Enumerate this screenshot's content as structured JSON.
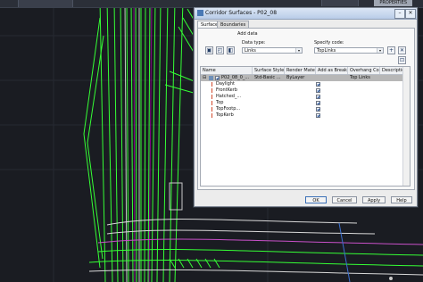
{
  "topbar": {
    "properties_label": "PROPERTIES"
  },
  "dialog": {
    "title": "Corridor Surfaces - P02_08",
    "tabs": [
      {
        "label": "Surfaces"
      },
      {
        "label": "Boundaries"
      }
    ],
    "add_data_label": "Add data",
    "data_type_label": "Data type:",
    "data_type_value": "Links",
    "specify_code_label": "Specify code:",
    "specify_code_value": "TopLinks",
    "table": {
      "columns": [
        "Name",
        "Surface Style",
        "Render Mater...",
        "Add as Breakl...",
        "Overhang Co...",
        "Description"
      ],
      "rows": [
        {
          "name": "P02_08_0_...",
          "surface_style": "Std-Basic ...",
          "render_material": "ByLayer",
          "overhang": "Top Links",
          "selected": true,
          "breakline": false
        },
        {
          "name": "Daylight",
          "breakline": true
        },
        {
          "name": "FrontKerb",
          "breakline": true
        },
        {
          "name": "Hatched_...",
          "breakline": true
        },
        {
          "name": "Top",
          "breakline": true
        },
        {
          "name": "TopFootp...",
          "breakline": true
        },
        {
          "name": "TopKerb",
          "breakline": true
        }
      ]
    },
    "buttons": {
      "ok": "OK",
      "cancel": "Cancel",
      "apply": "Apply",
      "help": "Help"
    }
  }
}
